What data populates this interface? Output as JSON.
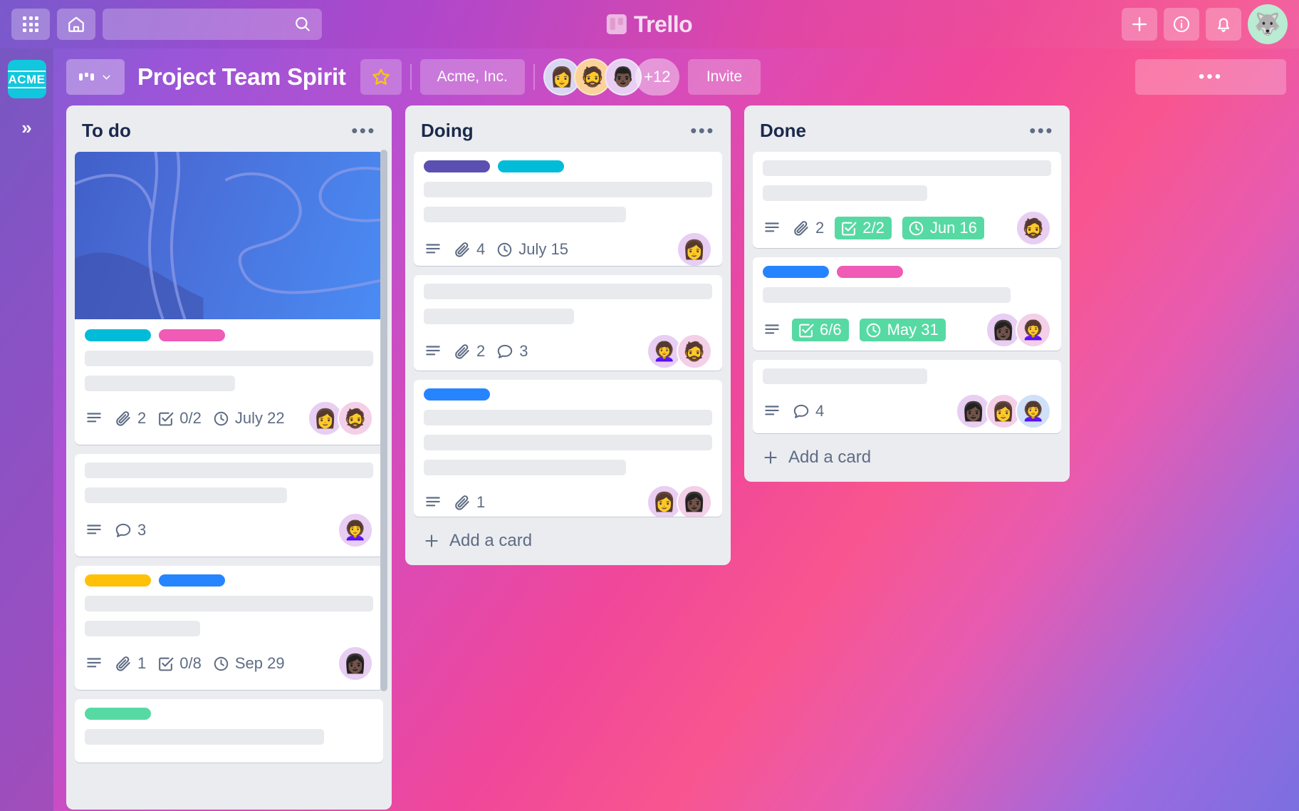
{
  "topbar": {
    "apps_icon": "grid-apps-icon",
    "home_icon": "home-icon",
    "search_placeholder": "",
    "search_value": "",
    "search_icon": "search-icon",
    "brand_name": "Trello",
    "brand_icon": "trello-logo-icon",
    "add_icon": "plus-icon",
    "info_icon": "info-circle-icon",
    "notifications_icon": "bell-icon",
    "profile_avatar": "husky-dog-avatar"
  },
  "leftrail": {
    "workspace_logo": "ACME",
    "expand_label": "»"
  },
  "boardbar": {
    "view_switch_label": "",
    "view_switch_icon": "board-view-icon",
    "chevron_icon": "chevron-down-icon",
    "board_title": "Project Team Spirit",
    "star_icon": "star-icon",
    "team_name": "Acme, Inc.",
    "members": [
      "👩",
      "🧔",
      "👨"
    ],
    "members_overflow": "+12",
    "invite_label": "Invite",
    "more_label": "•••"
  },
  "colors": {
    "label_cyan": "#00bcd9",
    "label_pink": "#ef5bb5",
    "label_yellow": "#ffc107",
    "label_blue": "#2684ff",
    "label_purple": "#5b50b2",
    "label_green": "#57d9a3",
    "badge_green": "#57d9a3",
    "list_bg": "#ebecf0",
    "card_bg": "#ffffff",
    "text_muted": "#5e6c84",
    "title_dark": "#1b2a4b",
    "brand_teal": "#11c7de"
  },
  "lists": [
    {
      "title": "To do",
      "more_icon": "list-menu-icon",
      "cards": [
        {
          "has_cover": true,
          "cover_style": "blue-abstract-waves",
          "labels": [
            "#00bcd9",
            "#ef5bb5"
          ],
          "title_lines": [
            "w100",
            "w52"
          ],
          "badges": {
            "description": true,
            "attachments": "2",
            "checklist": "0/2",
            "due": "July 22",
            "due_complete": false
          },
          "avatars": [
            "👩",
            "🧔"
          ]
        },
        {
          "has_cover": false,
          "labels": [],
          "title_lines": [
            "w100",
            "w70"
          ],
          "badges": {
            "description": true,
            "comments": "3"
          },
          "avatars": [
            "👩‍🦱"
          ]
        },
        {
          "has_cover": false,
          "labels": [
            "#ffc107",
            "#2684ff"
          ],
          "title_lines": [
            "w100",
            "w40"
          ],
          "badges": {
            "description": true,
            "attachments": "1",
            "checklist": "0/8",
            "due": "Sep 29",
            "due_complete": false
          },
          "avatars": [
            "👩🏿"
          ]
        },
        {
          "has_cover": false,
          "labels": [
            "#57d9a3"
          ],
          "title_lines": [
            "w83"
          ],
          "badges": {},
          "avatars": []
        }
      ],
      "add_card_label": "Add a card",
      "show_add_card": false
    },
    {
      "title": "Doing",
      "more_icon": "list-menu-icon",
      "cards": [
        {
          "has_cover": false,
          "labels": [
            "#5b50b2",
            "#00bcd9"
          ],
          "title_lines": [
            "w100",
            "w70"
          ],
          "badges": {
            "description": true,
            "attachments": "4",
            "due": "July 15",
            "due_complete": false
          },
          "avatars": [
            "👩"
          ]
        },
        {
          "has_cover": false,
          "labels": [],
          "title_lines": [
            "w100",
            "w52"
          ],
          "badges": {
            "description": true,
            "comments": "3",
            "attachments": "2"
          },
          "avatars": [
            "👩‍🦱",
            "🧔"
          ]
        },
        {
          "has_cover": false,
          "labels": [
            "#2684ff"
          ],
          "title_lines": [
            "w100",
            "w100",
            "w70"
          ],
          "badges": {
            "description": true,
            "attachments": "1"
          },
          "avatars": [
            "👩",
            "👩🏿"
          ]
        }
      ],
      "add_card_label": "Add a card",
      "show_add_card": true
    },
    {
      "title": "Done",
      "more_icon": "list-menu-icon",
      "cards": [
        {
          "has_cover": false,
          "labels": [],
          "title_lines": [
            "w100",
            "w57"
          ],
          "badges": {
            "description": true,
            "attachments": "2",
            "checklist": "2/2",
            "due": "Jun 16",
            "due_complete": true
          },
          "avatars": [
            "🧔"
          ]
        },
        {
          "has_cover": false,
          "labels": [
            "#2684ff",
            "#ef5bb5"
          ],
          "title_lines": [
            "w86"
          ],
          "badges": {
            "description": true,
            "checklist": "6/6",
            "due": "May 31",
            "due_complete": true
          },
          "avatars": [
            "👩🏿",
            "👩‍🦱"
          ]
        },
        {
          "has_cover": false,
          "labels": [],
          "title_lines": [
            "w57"
          ],
          "badges": {
            "description": true,
            "comments": "4"
          },
          "avatars": [
            "👩🏿",
            "👩",
            "👩‍🦱"
          ]
        }
      ],
      "add_card_label": "Add a card",
      "show_add_card": true
    }
  ]
}
